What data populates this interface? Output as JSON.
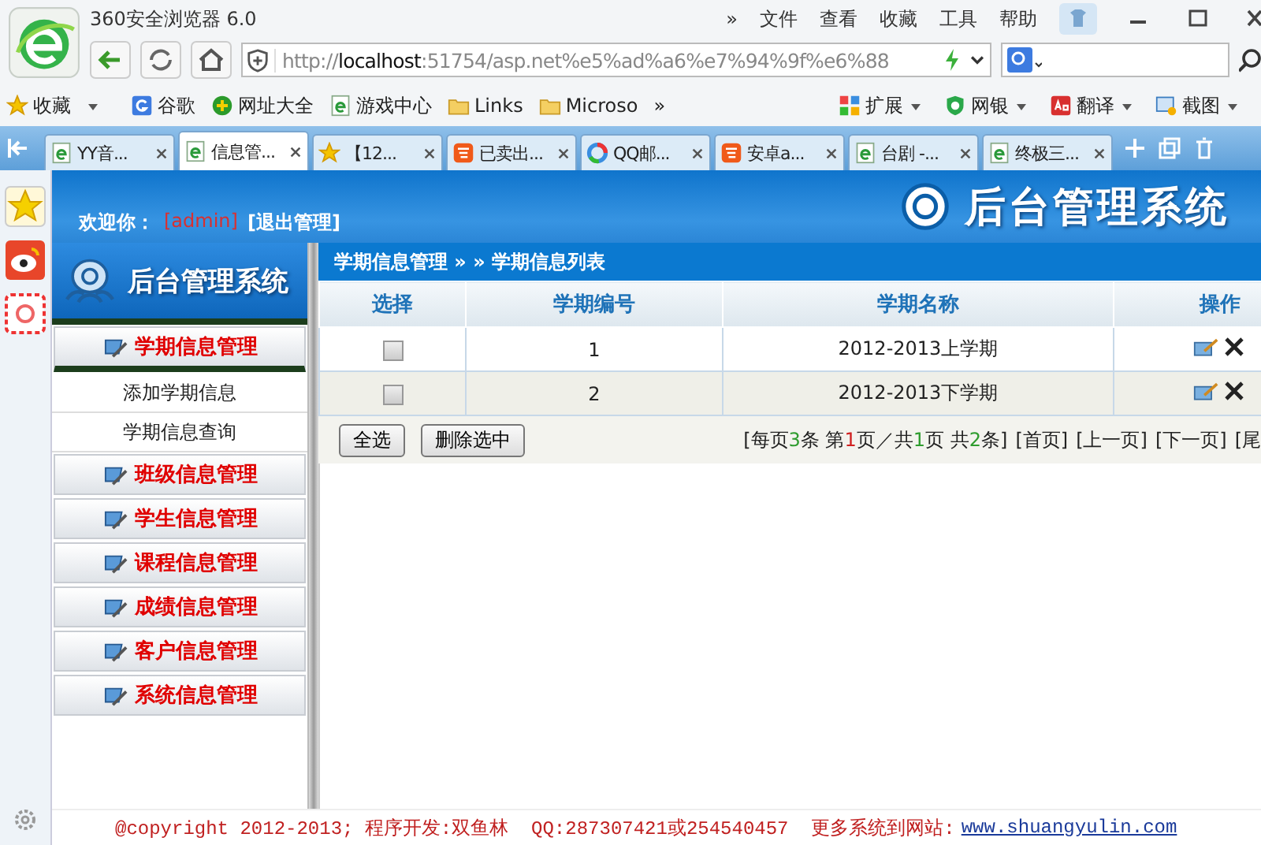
{
  "browser": {
    "title": "360安全浏览器 6.0",
    "menu": [
      "»",
      "文件",
      "查看",
      "收藏",
      "工具",
      "帮助"
    ],
    "address": {
      "scheme": "http://",
      "host": "localhost",
      "rest": ":51754/asp.net%e5%ad%a6%e7%94%9f%e6%88"
    },
    "bookmarks": [
      {
        "label": "收藏",
        "kind": "star"
      },
      {
        "label": "谷歌",
        "kind": "google"
      },
      {
        "label": "网址大全",
        "kind": "plus"
      },
      {
        "label": "游戏中心",
        "kind": "ie"
      },
      {
        "label": "Links",
        "kind": "folder"
      },
      {
        "label": "Microso",
        "kind": "folder"
      }
    ],
    "bookmarks_more": "»",
    "tools": [
      {
        "label": "扩展",
        "kind": "grid"
      },
      {
        "label": "网银",
        "kind": "shield"
      },
      {
        "label": "翻译",
        "kind": "dict"
      },
      {
        "label": "截图",
        "kind": "shot"
      }
    ],
    "tabs": [
      {
        "label": "YY音...",
        "kind": "ie",
        "selected": false
      },
      {
        "label": "信息管...",
        "kind": "ie",
        "selected": true
      },
      {
        "label": "【12...",
        "kind": "star",
        "selected": false
      },
      {
        "label": "已卖出...",
        "kind": "tao",
        "selected": false
      },
      {
        "label": "QQ邮...",
        "kind": "qq",
        "selected": false
      },
      {
        "label": "安卓a...",
        "kind": "tao",
        "selected": false
      },
      {
        "label": "台剧 -...",
        "kind": "ie",
        "selected": false
      },
      {
        "label": "终极三...",
        "kind": "ie",
        "selected": false
      }
    ]
  },
  "page": {
    "welcome": "欢迎你：",
    "user": "[admin]",
    "logout": "[退出管理]",
    "header_logo": "后台管理系统",
    "menu_logo": "后台管理系统",
    "menu": [
      {
        "label": "学期信息管理",
        "expanded": true,
        "children": [
          {
            "label": "添加学期信息"
          },
          {
            "label": "学期信息查询"
          }
        ]
      },
      {
        "label": "班级信息管理",
        "expanded": false
      },
      {
        "label": "学生信息管理",
        "expanded": false
      },
      {
        "label": "课程信息管理",
        "expanded": false
      },
      {
        "label": "成绩信息管理",
        "expanded": false
      },
      {
        "label": "客户信息管理",
        "expanded": false
      },
      {
        "label": "系统信息管理",
        "expanded": false
      }
    ],
    "breadcrumb": "学期信息管理 » » 学期信息列表",
    "table": {
      "columns": [
        "选择",
        "学期编号",
        "学期名称",
        "操作"
      ],
      "rows": [
        {
          "checked": false,
          "id": "1",
          "name": "2012-2013上学期"
        },
        {
          "checked": false,
          "id": "2",
          "name": "2012-2013下学期"
        }
      ]
    },
    "buttons": [
      "全选",
      "删除选中"
    ],
    "pager_info": [
      {
        "text": "[每页"
      },
      {
        "text": "3",
        "color": "#2e9c2e"
      },
      {
        "text": "条 第"
      },
      {
        "text": "1",
        "color": "#d02020"
      },
      {
        "text": "页／共"
      },
      {
        "text": "1",
        "color": "#2e9c2e"
      },
      {
        "text": "页 共"
      },
      {
        "text": "2",
        "color": "#2e9c2e"
      },
      {
        "text": "条]"
      }
    ],
    "pager_links": [
      "[首页]",
      "[上一页]",
      "[下一页]",
      "[尾"
    ],
    "footer": {
      "text": "@copyright 2012-2013; 程序开发:双鱼林  QQ:287307421或254540457  更多系统到网站:",
      "link": "www.shuangyulin.com"
    }
  }
}
